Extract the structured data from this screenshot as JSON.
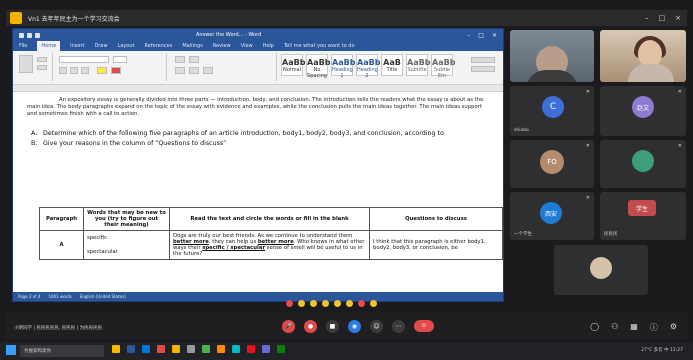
{
  "meeting": {
    "title": "Vn1 去年年民主为一个学习交流会"
  },
  "word": {
    "doc_title": "Answer the Word... - Word",
    "tabs": [
      "File",
      "Home",
      "Insert",
      "Draw",
      "Layout",
      "References",
      "Mailings",
      "Review",
      "View",
      "Help",
      "Tell me what you want to do"
    ],
    "active_tab": "Home",
    "paragraph_text": "An expository essay is generally divided into three parts — introduction, body, and conclusion. The introduction tells the readers what the essay is about as the main idea. The body paragraphs expand on the topic of the essay with evidence and examples, while the conclusion pulls the main ideas together. The main ideas support and sometimes finish with a call to action.",
    "list": [
      {
        "label": "A.",
        "text": "Determine which of the following five paragraphs of an article introduction, body1, body2, body3, and conclusion, according to"
      },
      {
        "label": "B.",
        "text": "Give your reasons in the column of “Questions to discuss”"
      }
    ],
    "table": {
      "headers": [
        "Paragraph",
        "Words that may be new to you (try to figure out their meaning)",
        "Read the text and circle the words or fill in the blank",
        "Questions to discuss"
      ],
      "row": {
        "paragraph": "A",
        "words": [
          "specific",
          "spectacular"
        ],
        "text_before": "Dogs are truly our best friends. As we continue to understand them",
        "underlined_1": "better more",
        "text_mid": ", they can help us",
        "underlined_2": "better more",
        "text_after": ". Who knows in what other ways their",
        "underlined_3": "specific / spectacular",
        "text_end": "sense of smell will be useful to us in the future?",
        "discussion": "I think that this paragraph is either body1, body2, body3, or conclusion, be"
      }
    },
    "styles": [
      "Normal",
      "No Spacing",
      "Heading 1",
      "Heading 2",
      "Title",
      "Subtitle",
      "Subtle Em"
    ],
    "status": [
      "Page 2 of 4",
      "1001 words",
      "English (United States)"
    ]
  },
  "participants": [
    {
      "name": "",
      "type": "video"
    },
    {
      "name": "",
      "type": "video"
    },
    {
      "name": "shiobo",
      "initial": "C",
      "color": "#3c6fd8"
    },
    {
      "name": "",
      "initial": "赵文",
      "color": "#8f7ad1"
    },
    {
      "name": "",
      "initial": "FO",
      "color": "#b58b6e"
    },
    {
      "name": "",
      "initial": "",
      "color": "#3d9e7a"
    },
    {
      "name": "一个学生",
      "initial": "西安",
      "color": "#1e7bd8"
    },
    {
      "name": "民民民",
      "initial": "学生",
      "color": "#c24b4b"
    },
    {
      "name": "",
      "initial": "",
      "color": "#d6c2a8"
    }
  ],
  "bottom": {
    "left_text": "小明同学 | 民民民民民, 民民民 | 为民民民民"
  },
  "taskbar": {
    "search": "为搜索和类你",
    "tray": "27°C 多云  中  11:27"
  }
}
